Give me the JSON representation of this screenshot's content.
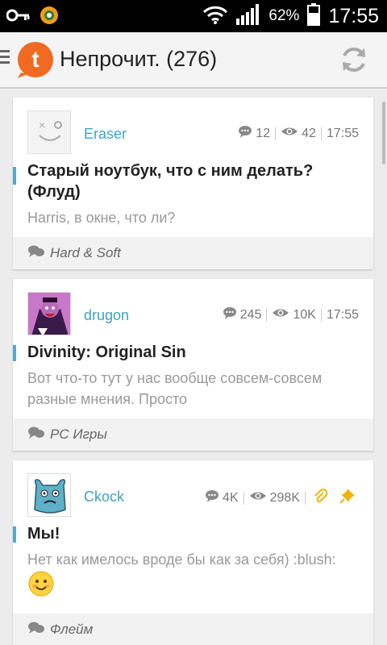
{
  "statusbar": {
    "battery_pct": "62%",
    "time": "17:55"
  },
  "actionbar": {
    "title": "Непрочит. (276)"
  },
  "posts": [
    {
      "author": "Eraser",
      "comments": "12",
      "views": "42",
      "time": "17:55",
      "title": "Старый ноутбук, что с ним делать? (Флуд)",
      "preview": "Harris, в окне, что ли?",
      "forum": "Hard & Soft"
    },
    {
      "author": "drugon",
      "comments": "245",
      "views": "10K",
      "time": "17:55",
      "title": "Divinity: Original Sin",
      "preview": "Вот что-то тут у нас вообще совсем-совсем разные мнения. Просто",
      "forum": "PC Игры"
    },
    {
      "author": "Ckock",
      "comments": "4K",
      "views": "298K",
      "title": "Мы!",
      "preview": "Нет как имелось вроде бы как за себя) :blush:",
      "forum": "Флейм"
    }
  ],
  "colors": {
    "accent": "#56a9c6",
    "author": "#3fa3c2",
    "logo": "#f06a22",
    "pin": "#f0b400"
  }
}
